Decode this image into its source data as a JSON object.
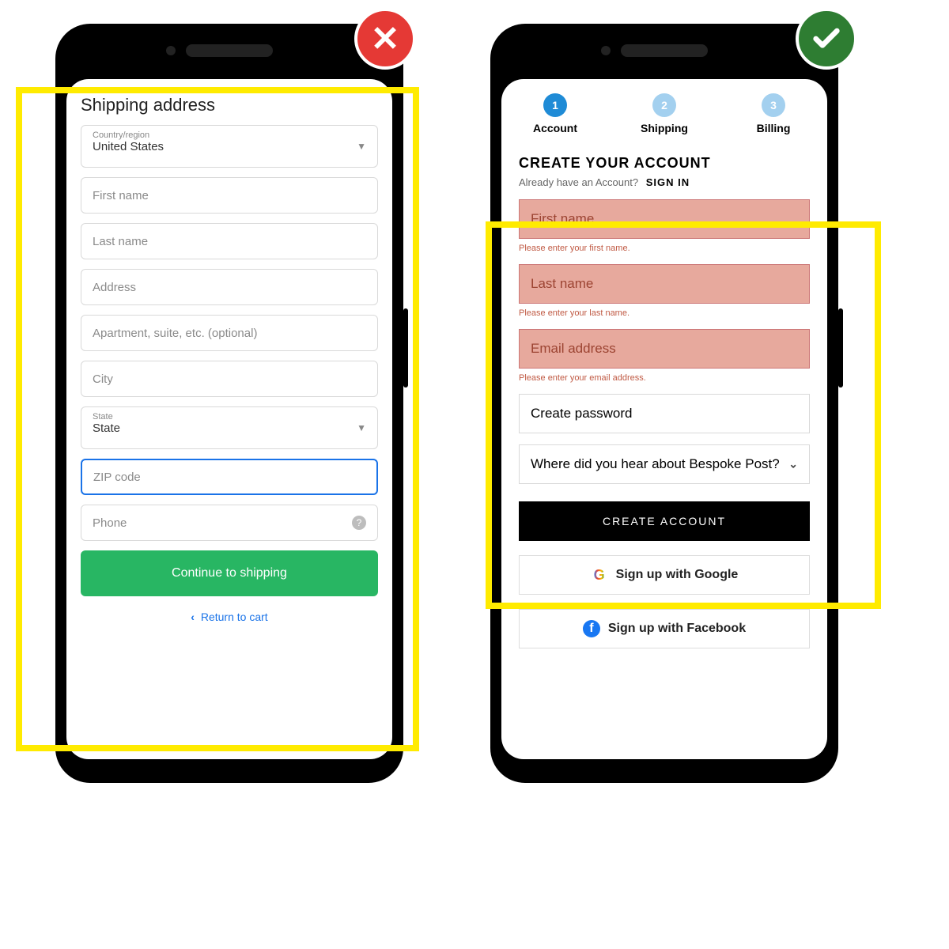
{
  "left": {
    "title": "Shipping address",
    "country_label": "Country/region",
    "country_value": "United States",
    "first_name_ph": "First name",
    "last_name_ph": "Last name",
    "address_ph": "Address",
    "apt_ph": "Apartment, suite, etc. (optional)",
    "city_ph": "City",
    "state_label": "State",
    "state_value": "State",
    "zip_ph": "ZIP code",
    "phone_ph": "Phone",
    "cta": "Continue to shipping",
    "return": "Return to cart"
  },
  "right": {
    "steps": [
      {
        "num": "1",
        "label": "Account"
      },
      {
        "num": "2",
        "label": "Shipping"
      },
      {
        "num": "3",
        "label": "Billing"
      }
    ],
    "heading": "CREATE YOUR ACCOUNT",
    "already": "Already have an Account?",
    "signin": "SIGN IN",
    "first_name_ph": "First name",
    "first_name_err": "Please enter your first name.",
    "last_name_ph": "Last name",
    "last_name_err": "Please enter your last name.",
    "email_ph": "Email address",
    "email_err": "Please enter your email address.",
    "password_ph": "Create password",
    "source_ph": "Where did you hear about Bespoke Post?",
    "cta": "CREATE ACCOUNT",
    "google": "Sign up with Google",
    "facebook": "Sign up with Facebook"
  },
  "badges": {
    "bad_glyph": "✕",
    "good_glyph": "check"
  }
}
